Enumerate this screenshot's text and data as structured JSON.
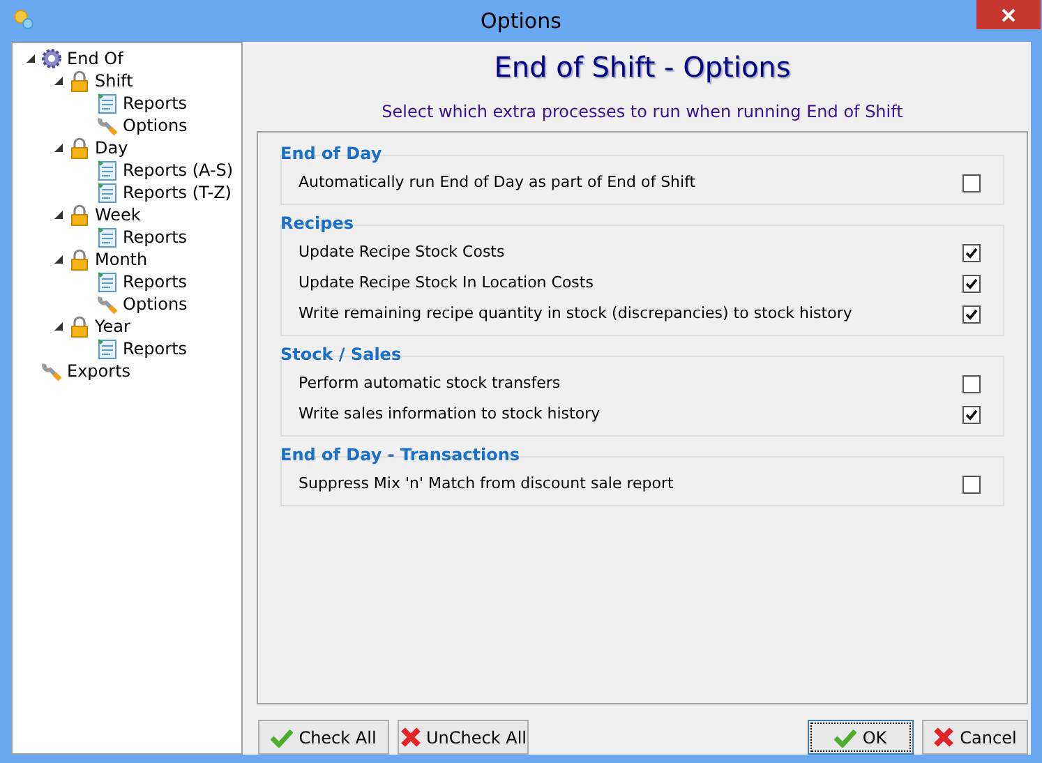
{
  "window": {
    "title": "Options"
  },
  "tree": [
    {
      "label": "End Of",
      "kind": "gear",
      "expanded": true,
      "children": [
        {
          "label": "Shift",
          "kind": "lock",
          "expanded": true,
          "children": [
            {
              "label": "Reports",
              "kind": "report"
            },
            {
              "label": "Options",
              "kind": "wrench"
            }
          ]
        },
        {
          "label": "Day",
          "kind": "lock",
          "expanded": true,
          "children": [
            {
              "label": "Reports (A-S)",
              "kind": "report"
            },
            {
              "label": "Reports (T-Z)",
              "kind": "report"
            }
          ]
        },
        {
          "label": "Week",
          "kind": "lock",
          "expanded": true,
          "children": [
            {
              "label": "Reports",
              "kind": "report"
            }
          ]
        },
        {
          "label": "Month",
          "kind": "lock",
          "expanded": true,
          "children": [
            {
              "label": "Reports",
              "kind": "report"
            },
            {
              "label": "Options",
              "kind": "wrench"
            }
          ]
        },
        {
          "label": "Year",
          "kind": "lock",
          "expanded": true,
          "children": [
            {
              "label": "Reports",
              "kind": "report"
            }
          ]
        }
      ]
    },
    {
      "label": "Exports",
      "kind": "wrench"
    }
  ],
  "heading": "End of Shift - Options",
  "subheading": "Select which extra processes to run when running End of Shift",
  "groups": [
    {
      "title": "End of Day",
      "options": [
        {
          "label": "Automatically run End of Day as part of End of Shift",
          "checked": false
        }
      ]
    },
    {
      "title": "Recipes",
      "options": [
        {
          "label": "Update Recipe Stock Costs",
          "checked": true
        },
        {
          "label": "Update Recipe Stock In Location Costs",
          "checked": true
        },
        {
          "label": "Write remaining recipe quantity in stock (discrepancies) to stock history",
          "checked": true
        }
      ]
    },
    {
      "title": "Stock / Sales",
      "options": [
        {
          "label": "Perform automatic stock transfers",
          "checked": false
        },
        {
          "label": "Write sales information to stock history",
          "checked": true
        }
      ]
    },
    {
      "title": "End of Day - Transactions",
      "options": [
        {
          "label": "Suppress Mix 'n' Match from discount sale report",
          "checked": false
        }
      ]
    }
  ],
  "buttons": [
    {
      "label": "Check All",
      "kind": "check"
    },
    {
      "label": "UnCheck All",
      "kind": "cross"
    },
    {
      "label": "OK",
      "kind": "ok"
    },
    {
      "label": "Cancel",
      "kind": "cross"
    }
  ]
}
